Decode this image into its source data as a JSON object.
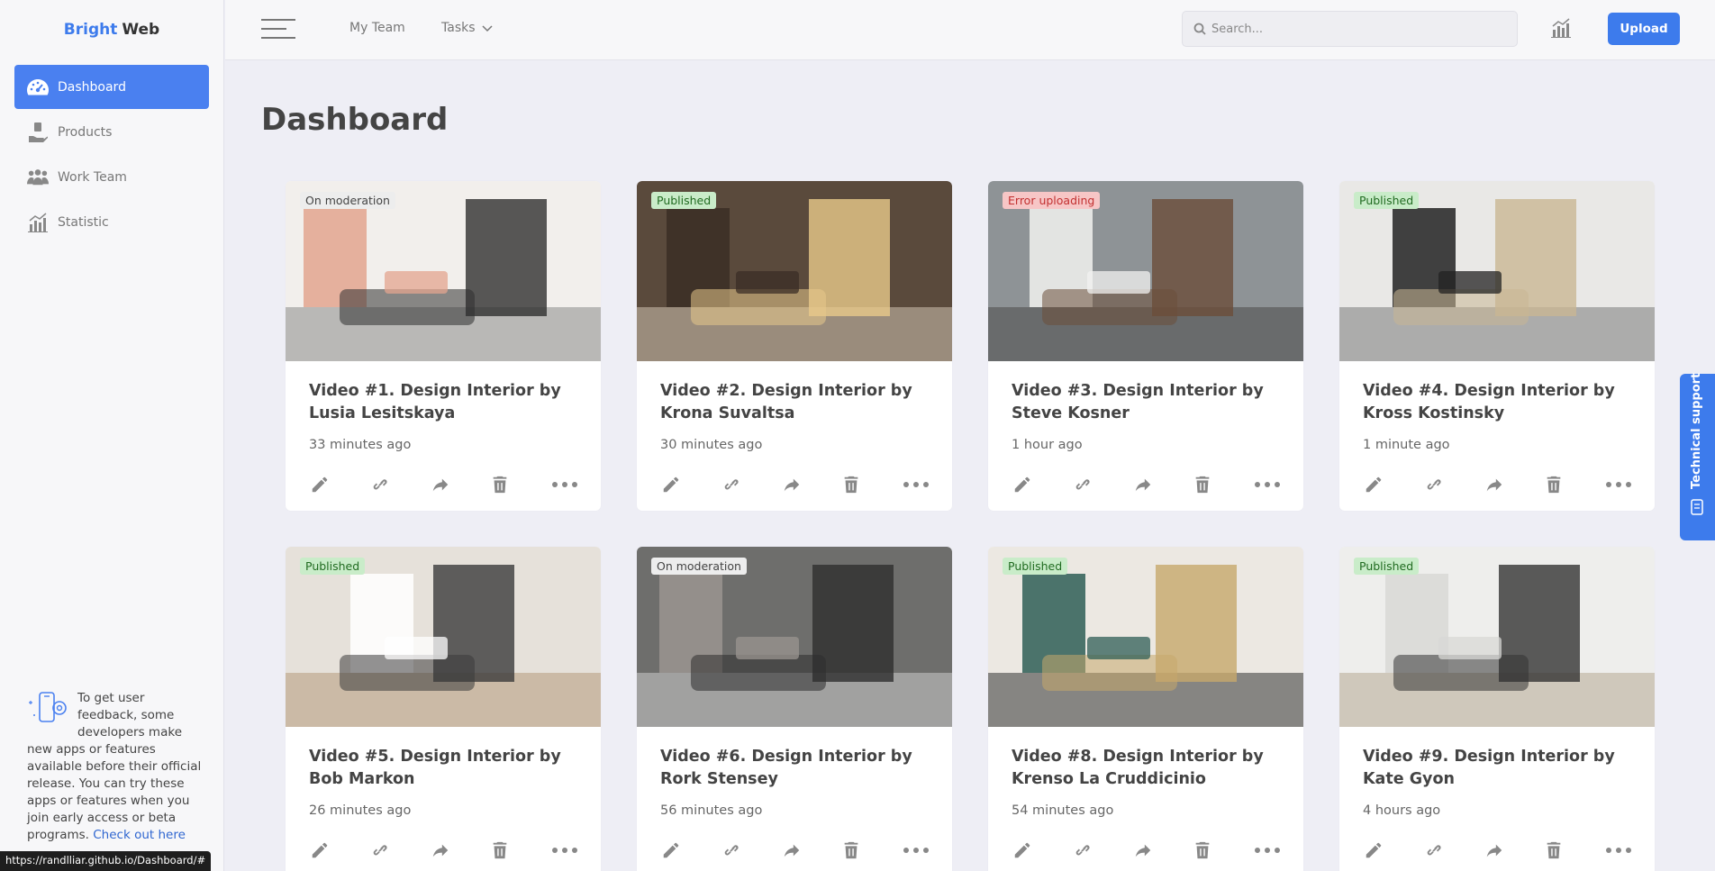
{
  "brand": {
    "part1": "Bright",
    "part2": "Web"
  },
  "sidebar": {
    "items": [
      {
        "label": "Dashboard",
        "icon": "gauge-icon",
        "active": true
      },
      {
        "label": "Products",
        "icon": "hand-box-icon",
        "active": false
      },
      {
        "label": "Work Team",
        "icon": "people-icon",
        "active": false
      },
      {
        "label": "Statistic",
        "icon": "bar-chart-icon",
        "active": false
      }
    ],
    "promo": {
      "text": "To get user feedback, some developers make new apps or features available before their official release. You can try these apps or features when you join early access or beta programs.",
      "link": "Check out here"
    }
  },
  "topbar": {
    "nav": [
      "My Team",
      "Tasks"
    ],
    "search_placeholder": "Search...",
    "upload_label": "Upload"
  },
  "main": {
    "title": "Dashboard",
    "cards": [
      {
        "title": "Video #1. Design Interior by Lusia Lesitskaya",
        "time": "33 minutes ago",
        "status": "On moderation",
        "status_type": "moderation"
      },
      {
        "title": "Video #2. Design Interior by Krona Suvaltsa",
        "time": "30 minutes ago",
        "status": "Published",
        "status_type": "published"
      },
      {
        "title": "Video #3. Design Interior by Steve Kosner",
        "time": "1 hour ago",
        "status": "Error uploading",
        "status_type": "error"
      },
      {
        "title": "Video #4. Design Interior by Kross Kostinsky",
        "time": "1 minute ago",
        "status": "Published",
        "status_type": "published"
      },
      {
        "title": "Video #5. Design Interior by Bob Markon",
        "time": "26 minutes ago",
        "status": "Published",
        "status_type": "published"
      },
      {
        "title": "Video #6. Design Interior by Rork Stensey",
        "time": "56 minutes ago",
        "status": "On moderation",
        "status_type": "moderation"
      },
      {
        "title": "Video #8. Design Interior by Krenso La Cruddicinio",
        "time": "54 minutes ago",
        "status": "Published",
        "status_type": "published"
      },
      {
        "title": "Video #9. Design Interior by Kate Gyon",
        "time": "4 hours ago",
        "status": "Published",
        "status_type": "published"
      }
    ]
  },
  "support_label": "Technical support",
  "statusbar_url": "https://randlliar.github.io/Dashboard/#",
  "colors": {
    "accent": "#3d7bec",
    "published": "#c9ecc9",
    "error": "#f7c6c6",
    "moderation": "#ededed"
  }
}
